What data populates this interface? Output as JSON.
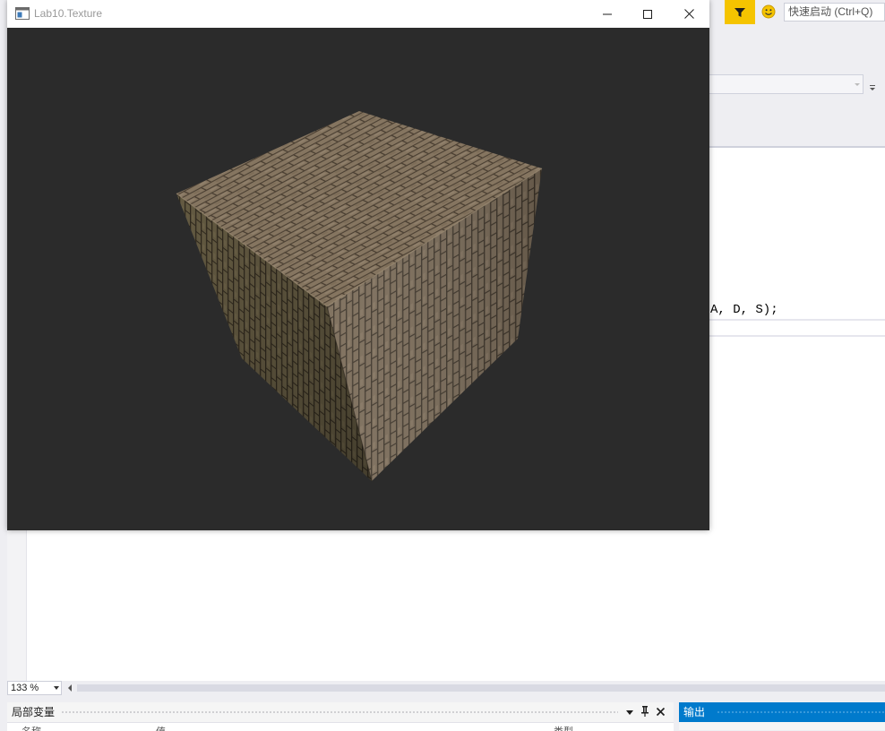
{
  "app_window": {
    "title": "Lab10.Texture",
    "icon": "app-window-icon",
    "controls": {
      "minimize": "minimize-icon",
      "maximize": "maximize-icon",
      "close": "close-icon"
    },
    "viewport_bg": "#2b2b2b",
    "scene": {
      "object": "brick-textured-cube"
    }
  },
  "ide": {
    "toolbar": {
      "filter_icon": "filter-icon",
      "feedback_icon": "smiley-icon",
      "quick_launch_placeholder": "快速启动 (Ctrl+Q)",
      "accent": "#f5c400"
    },
    "editor": {
      "visible_code": "A, D, S);",
      "zoom": "133 %"
    },
    "locals_panel": {
      "title": "局部变量",
      "columns": [
        "名称",
        "值",
        "类型"
      ]
    },
    "output_panel": {
      "title": "输出",
      "accent": "#007acc"
    }
  }
}
